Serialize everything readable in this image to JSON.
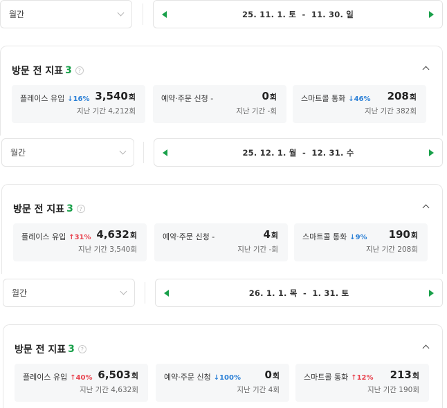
{
  "sections": [
    {
      "period_select": "월간",
      "range": "25. 11. 1. 토  -  11. 30. 일",
      "card_title": "방문 전 지표",
      "card_count": "3",
      "help": "?",
      "metrics": [
        {
          "label": "플레이스 유입",
          "delta": "↓16%",
          "delta_dir": "down",
          "value": "3,540",
          "unit": "회",
          "prev": "지난 기간 4,212회"
        },
        {
          "label": "예약·주문 신청 -",
          "delta": "",
          "delta_dir": "",
          "value": "0",
          "unit": "회",
          "prev": "지난 기간 -회"
        },
        {
          "label": "스마트콜 통화",
          "delta": "↓46%",
          "delta_dir": "down",
          "value": "208",
          "unit": "회",
          "prev": "지난 기간 382회"
        }
      ]
    },
    {
      "period_select": "월간",
      "range": "25. 12. 1. 월  -  12. 31. 수",
      "card_title": "방문 전 지표",
      "card_count": "3",
      "help": "?",
      "metrics": [
        {
          "label": "플레이스 유입",
          "delta": "↑31%",
          "delta_dir": "up",
          "value": "4,632",
          "unit": "회",
          "prev": "지난 기간 3,540회"
        },
        {
          "label": "예약·주문 신청 -",
          "delta": "",
          "delta_dir": "",
          "value": "4",
          "unit": "회",
          "prev": "지난 기간 -회"
        },
        {
          "label": "스마트콜 통화",
          "delta": "↓9%",
          "delta_dir": "down",
          "value": "190",
          "unit": "회",
          "prev": "지난 기간 208회"
        }
      ]
    },
    {
      "period_select": "월간",
      "range": "26. 1. 1. 목  -  1. 31. 토",
      "card_title": "방문 전 지표",
      "card_count": "3",
      "help": "?",
      "metrics": [
        {
          "label": "플레이스 유입",
          "delta": "↑40%",
          "delta_dir": "up",
          "value": "6,503",
          "unit": "회",
          "prev": "지난 기간 4,632회"
        },
        {
          "label": "예약·주문 신청",
          "delta": "↓100%",
          "delta_dir": "down",
          "value": "0",
          "unit": "회",
          "prev": "지난 기간 4회"
        },
        {
          "label": "스마트콜 통화",
          "delta": "↑12%",
          "delta_dir": "up",
          "value": "213",
          "unit": "회",
          "prev": "지난 기간 190회"
        }
      ]
    }
  ],
  "colors": {
    "accent_green": "#19a04a",
    "delta_down": "#2a7fd6",
    "delta_up": "#e8424e",
    "metric_bg": "#f6f7f8"
  },
  "icons": {
    "prev": "triangle-left-icon",
    "next": "triangle-right-icon",
    "dropdown": "chevron-down-icon",
    "collapse": "chevron-up-icon",
    "help": "question-circle-icon"
  }
}
